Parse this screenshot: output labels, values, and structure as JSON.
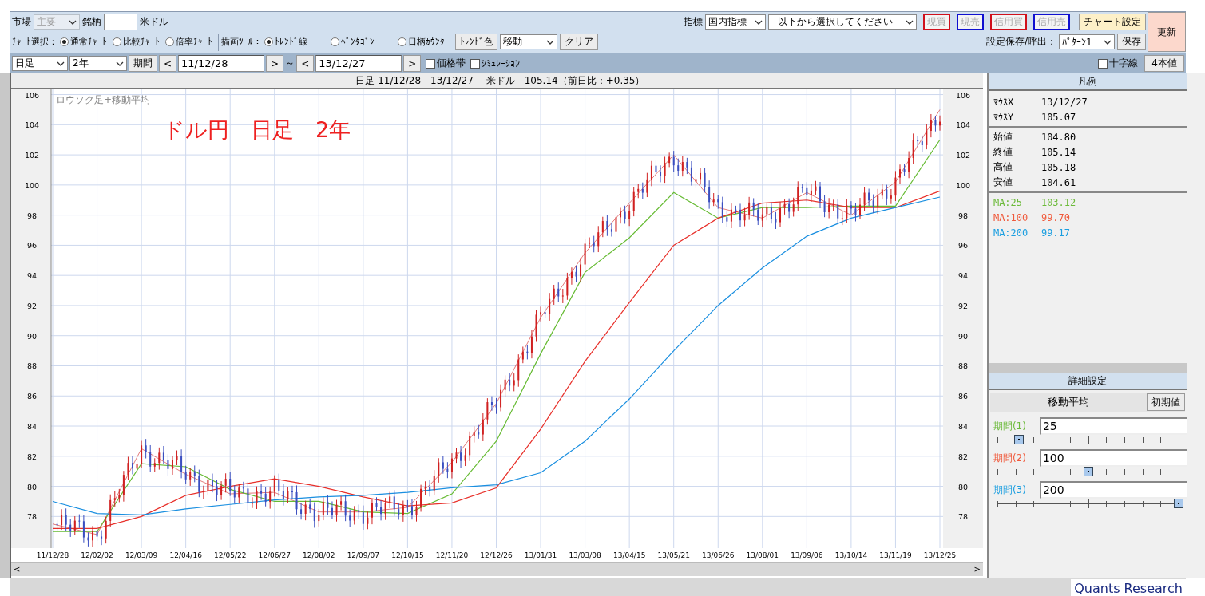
{
  "toolbar": {
    "market_label": "市場",
    "market_select": "主要",
    "symbol_label": "銘柄",
    "currency": "米ドル",
    "indicator_label": "指標",
    "indicator_select": "国内指標",
    "indicator_sub_select": "- 以下から選択してください -",
    "trade_buttons": [
      {
        "label": "現買",
        "color": "#d0101c",
        "disabled": true
      },
      {
        "label": "現売",
        "color": "#1010d0",
        "disabled": true
      },
      {
        "label": "信用買",
        "color": "#d0101c",
        "disabled": true
      },
      {
        "label": "信用売",
        "color": "#1010d0",
        "disabled": true
      }
    ],
    "chart_settings_button": "チャート設定",
    "refresh_button": "更新",
    "chart_select_label": "ﾁｬｰﾄ選択：",
    "chart_types": [
      {
        "label": "通常ﾁｬｰﾄ",
        "selected": true
      },
      {
        "label": "比較ﾁｬｰﾄ",
        "selected": false
      },
      {
        "label": "倍率ﾁｬｰﾄ",
        "selected": false
      }
    ],
    "draw_tool_label": "描画ﾂｰﾙ：",
    "draw_tools": [
      {
        "label": "ﾄﾚﾝﾄﾞ線",
        "selected": true
      },
      {
        "label": "ﾍﾟﾝﾀｺﾞﾝ",
        "selected": false
      },
      {
        "label": "日柄ｶｳﾝﾀｰ",
        "selected": false
      }
    ],
    "trend_color_button": "ﾄﾚﾝﾄﾞ色",
    "move_select": "移動",
    "clear_button": "クリア",
    "save_label": "設定保存/呼出：",
    "pattern_select": "ﾊﾟﾀｰﾝ1",
    "save_button": "保存"
  },
  "range_bar": {
    "interval_select": "日足",
    "span_select": "2年",
    "period_button": "期間",
    "prev_button": "<",
    "from_date": "11/12/28",
    "next_button": ">",
    "tilde": "～",
    "prev_button_2": "<",
    "to_date": "13/12/27",
    "next_button_2": ">",
    "checkboxes": [
      {
        "label": "価格帯",
        "checked": false
      },
      {
        "label": "ｼﾐｭﾚｰｼｮﾝ",
        "checked": false
      }
    ],
    "crosshair": {
      "label": "十字線",
      "checked": false
    },
    "four_values_button": "4本値"
  },
  "chart": {
    "header": "日足 11/12/28 - 13/12/27　 米ドル　105.14（前日比：+0.35）",
    "caption": "ロウソク足+移動平均",
    "annotation": "ドル円　日足　2年",
    "chart_data": {
      "type": "line",
      "categories": [
        "11/12/28",
        "12/02/02",
        "12/03/09",
        "12/04/16",
        "12/05/22",
        "12/06/27",
        "12/08/02",
        "12/09/07",
        "12/10/15",
        "12/11/20",
        "12/12/26",
        "13/01/31",
        "13/03/08",
        "13/04/15",
        "13/05/21",
        "13/06/26",
        "13/08/01",
        "13/09/06",
        "13/10/14",
        "13/11/19",
        "13/12/25"
      ],
      "series": [
        {
          "color": "#d02020",
          "values": [
            77.5,
            76.8,
            82.5,
            80.8,
            79.5,
            79.6,
            78.3,
            78.3,
            78.6,
            81.6,
            85.5,
            91.2,
            95.5,
            98.8,
            102.0,
            98.5,
            97.8,
            99.5,
            98.0,
            100.2,
            105.0
          ]
        },
        {
          "color": "#66bb33",
          "values": [
            77.0,
            77.0,
            81.5,
            81.3,
            79.8,
            79.0,
            79.0,
            78.3,
            78.2,
            79.5,
            83.0,
            88.8,
            94.2,
            96.5,
            99.5,
            97.8,
            98.5,
            98.5,
            98.6,
            98.6,
            103.0
          ]
        },
        {
          "color": "#e8302a",
          "values": [
            77.2,
            77.2,
            78.0,
            79.4,
            80.0,
            80.5,
            80.0,
            79.3,
            78.7,
            78.9,
            79.9,
            83.8,
            88.3,
            92.2,
            96.0,
            97.8,
            98.8,
            99.0,
            98.5,
            98.5,
            99.6
          ]
        },
        {
          "color": "#1a8fe0",
          "values": [
            79.0,
            78.2,
            78.1,
            78.5,
            78.8,
            79.1,
            79.3,
            79.4,
            79.6,
            79.9,
            80.1,
            80.9,
            83.0,
            85.8,
            89.0,
            92.0,
            94.5,
            96.6,
            97.8,
            98.5,
            99.2
          ]
        }
      ],
      "ylim": [
        75.9,
        106.4
      ],
      "yticks": [
        78,
        80,
        82,
        84,
        86,
        88,
        90,
        92,
        94,
        96,
        98,
        100,
        102,
        104,
        106
      ],
      "grid": true
    },
    "right_axis_labels": [
      "106",
      "104",
      "102",
      "100",
      "98",
      "96",
      "94",
      "92",
      "90",
      "88",
      "86",
      "84",
      "82",
      "80",
      "78"
    ],
    "scroll_arrows": [
      "<",
      ">"
    ]
  },
  "legend": {
    "title": "凡例",
    "groups": [
      [
        {
          "label": "ﾏｳｽX",
          "value": "13/12/27"
        },
        {
          "label": "ﾏｳｽY",
          "value": "105.07"
        }
      ],
      [
        {
          "label": "始値",
          "value": "104.80"
        },
        {
          "label": "終値",
          "value": "105.14"
        },
        {
          "label": "高値",
          "value": "105.18"
        },
        {
          "label": "安値",
          "value": "104.61"
        }
      ],
      [
        {
          "label": "MA:25",
          "value": "103.12",
          "color": "#6cba3a"
        },
        {
          "label": "MA:100",
          "value": "99.70",
          "color": "#f05a3c"
        },
        {
          "label": "MA:200",
          "value": "99.17",
          "color": "#1a9ee0"
        }
      ]
    ]
  },
  "details": {
    "title": "詳細設定",
    "tab": "移動平均",
    "reset_button": "初期値",
    "periods": [
      {
        "label": "期間(1)",
        "value": "25",
        "color": "#6cba3a",
        "level": 0.12
      },
      {
        "label": "期間(2)",
        "value": "100",
        "color": "#f05a3c",
        "level": 0.5
      },
      {
        "label": "期間(3)",
        "value": "200",
        "color": "#1a9ee0",
        "level": 1.0
      }
    ]
  },
  "status_bar": {
    "brand": "Quants Research"
  }
}
